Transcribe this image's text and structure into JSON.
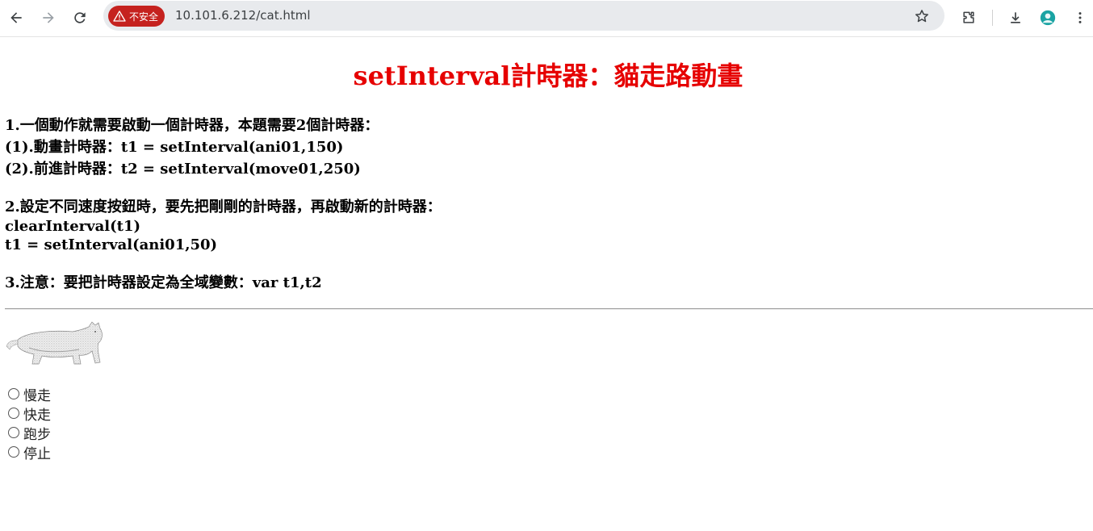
{
  "browser": {
    "security_label": "不安全",
    "url": "10.101.6.212/cat.html"
  },
  "page": {
    "title": "setInterval計時器：貓走路動畫",
    "section1": {
      "line1": "1.一個動作就需要啟動一個計時器，本題需要2個計時器：",
      "line2": "(1).動畫計時器：t1 = setInterval(ani01,150)",
      "line3": "(2).前進計時器：t2 = setInterval(move01,250)"
    },
    "section2": {
      "line1": "2.設定不同速度按鈕時，要先把剛剛的計時器，再啟動新的計時器：",
      "line2": "clearInterval(t1)",
      "line3": "t1 = setInterval(ani01,50)"
    },
    "section3": {
      "line1": "3.注意：要把計時器設定為全域變數：var t1,t2"
    },
    "speed_options": [
      {
        "label": "慢走"
      },
      {
        "label": "快走"
      },
      {
        "label": "跑步"
      },
      {
        "label": "停止"
      }
    ]
  },
  "colors": {
    "title": "#e60000",
    "security_chip": "#c5221f",
    "omnibox": "#e8eaed"
  }
}
